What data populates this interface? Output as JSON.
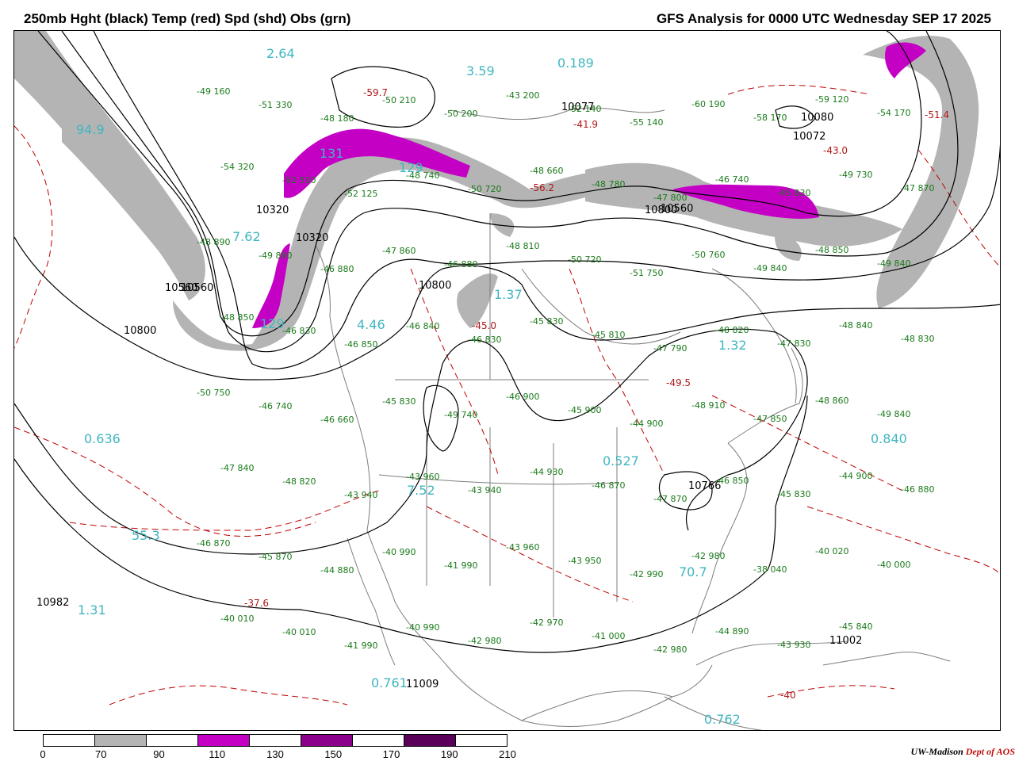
{
  "header": {
    "left_title": "250mb Hght (black) Temp (red) Spd (shd) Obs (grn)",
    "right_title": "GFS Analysis for 0000 UTC Wednesday  SEP 17 2025"
  },
  "colors": {
    "height_contour": "#000000",
    "temperature_contour": "#c00000",
    "speed_70_90": "#b4b4b4",
    "speed_110_130": "#c400c4",
    "observations": "#1a7a1a",
    "max_min_labels": "#3fb6c0"
  },
  "colorbar": {
    "ticks": [
      "0",
      "70",
      "90",
      "110",
      "130",
      "150",
      "170",
      "190",
      "210"
    ],
    "segments": [
      "#ffffff",
      "#b4b4b4",
      "#ffffff",
      "#c400c4",
      "#ffffff",
      "#8a008a",
      "#ffffff",
      "#5a005a",
      "#ffffff"
    ]
  },
  "credit": {
    "part1": "UW-Madison",
    "part2": "Dept of AOS"
  },
  "height_labels": [
    {
      "text": "10320"
    },
    {
      "text": "10560"
    },
    {
      "text": "10800"
    },
    {
      "text": "10560"
    },
    {
      "text": "10800"
    },
    {
      "text": "10800"
    },
    {
      "text": "10766"
    },
    {
      "text": "10982"
    },
    {
      "text": "11002"
    },
    {
      "text": "11009"
    },
    {
      "text": "10077"
    },
    {
      "text": "10080"
    },
    {
      "text": "10072"
    },
    {
      "text": "10320"
    },
    {
      "text": "10560"
    }
  ],
  "cyan_labels": [
    {
      "text": "94.9"
    },
    {
      "text": "7.62"
    },
    {
      "text": "131"
    },
    {
      "text": "4.46"
    },
    {
      "text": "0.636"
    },
    {
      "text": "55.3"
    },
    {
      "text": "1.31"
    },
    {
      "text": "0.761"
    },
    {
      "text": "0.762"
    },
    {
      "text": "70.7"
    },
    {
      "text": "0.527"
    },
    {
      "text": "0.840"
    },
    {
      "text": "1.32"
    },
    {
      "text": "1.37"
    },
    {
      "text": "2.64"
    },
    {
      "text": "3.59"
    },
    {
      "text": "0.189"
    },
    {
      "text": "129"
    },
    {
      "text": "129"
    },
    {
      "text": "7.52"
    }
  ],
  "red_labels": [
    {
      "text": "-37.6"
    },
    {
      "text": "-45.0"
    },
    {
      "text": "-41.9"
    },
    {
      "text": "-43.0"
    },
    {
      "text": "-51.4"
    },
    {
      "text": "-49.5"
    },
    {
      "text": "-59.7"
    },
    {
      "text": "-56.2"
    },
    {
      "text": "-40"
    }
  ],
  "observations": [
    "-49 160",
    "-51 330",
    "-48 180",
    "-50 210",
    "-50 200",
    "-43 200",
    "-52 140",
    "-55 140",
    "-60 190",
    "-58 170",
    "-59 120",
    "-54 170",
    "-54 320",
    "-52 510",
    "-52 125",
    "-48 740",
    "-50 720",
    "-48 660",
    "-48 780",
    "-47 800",
    "-46 740",
    "-45 830",
    "-49 730",
    "-47 870",
    "-48 890",
    "-49 860",
    "-46 880",
    "-47 860",
    "-46 880",
    "-48 810",
    "-50 720",
    "-51 750",
    "-50 760",
    "-49 840",
    "-48 850",
    "-49 840",
    "-48 850",
    "-46 830",
    "-46 850",
    "-46 840",
    "-46 830",
    "-45 830",
    "-45 810",
    "-47 790",
    "-48 820",
    "-47 830",
    "-48 840",
    "-48 830",
    "-50 750",
    "-46 740",
    "-46 660",
    "-45 830",
    "-49 740",
    "-46 900",
    "-45 900",
    "-44 900",
    "-48 910",
    "-47 850",
    "-48 860",
    "-49 840",
    "-47 840",
    "-48 820",
    "-43 940",
    "-43 960",
    "-43 940",
    "-44 930",
    "-46 870",
    "-47 870",
    "-46 850",
    "-45 830",
    "-44 900",
    "-46 880",
    "-46 870",
    "-45 870",
    "-44 880",
    "-40 990",
    "-41 990",
    "-43 960",
    "-43 950",
    "-42 990",
    "-42 980",
    "-38 040",
    "-40 020",
    "-40 000",
    "-40 010",
    "-40 010",
    "-41 990",
    "-40 990",
    "-42 980",
    "-42 970",
    "-41 000",
    "-42 980",
    "-44 890",
    "-43 930",
    "-45 840"
  ]
}
